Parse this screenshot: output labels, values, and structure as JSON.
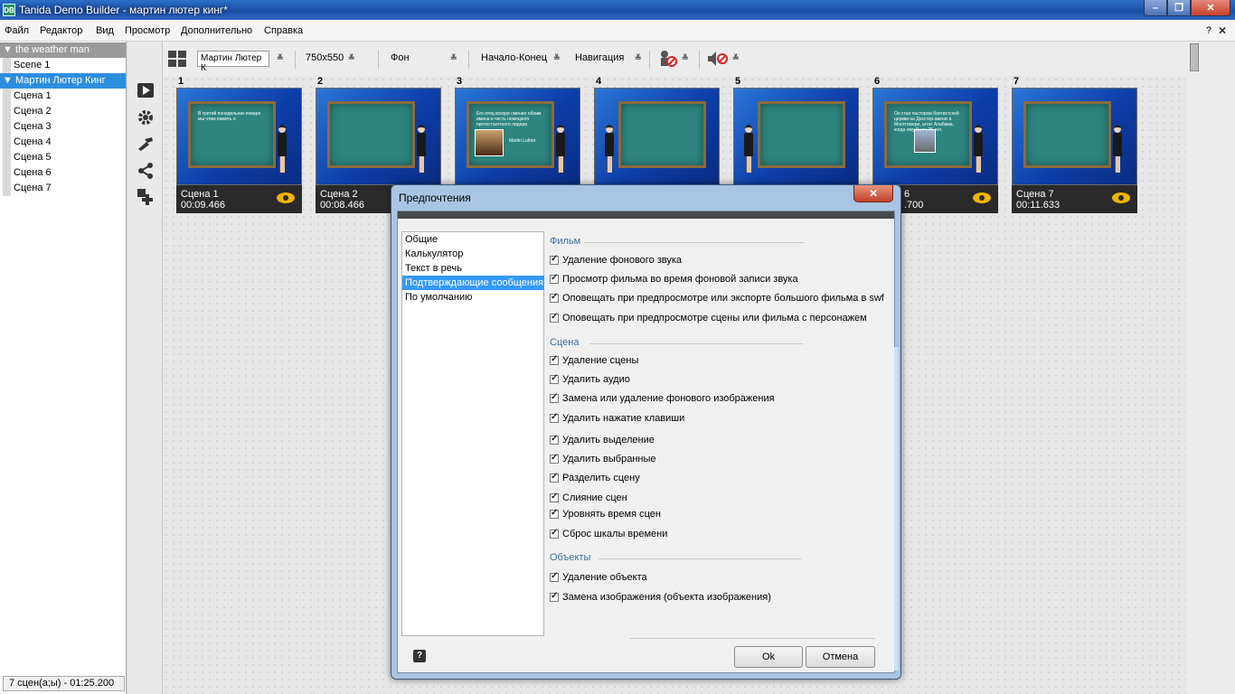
{
  "window": {
    "app_icon_text": "DB",
    "title": "Tanida Demo Builder - мартин лютер кинг*",
    "minimize": "‒",
    "maximize": "❐",
    "close": "✕"
  },
  "menu": {
    "items": [
      "Файл",
      "Редактор",
      "Вид",
      "Просмотр",
      "Дополнительно",
      "Справка"
    ],
    "help": "?",
    "close": "✕"
  },
  "project_tree": {
    "projects": [
      {
        "name": "the weather man",
        "scenes": [
          "Scene 1"
        ]
      },
      {
        "name": "Мартин Лютер Кинг",
        "scenes": [
          "Сцена 1",
          "Сцена 2",
          "Сцена 3",
          "Сцена 4",
          "Сцена 5",
          "Сцена 6",
          "Сцена 7"
        ]
      }
    ],
    "expand_glyph": "▼",
    "status": "7 сцен(а;ы) - 01:25.200"
  },
  "toolbar": {
    "project_select": "Мартин Лютер К",
    "size": "750x550",
    "background": "Фон",
    "start_end": "Начало-Конец",
    "navigation": "Навигация",
    "chevron": "≚"
  },
  "scenes": [
    {
      "num": "1",
      "name": "Сцена 1",
      "time": "00:09.466",
      "board_text": "В третий понедельник января мы чтим память о"
    },
    {
      "num": "2",
      "name": "Сцена 2",
      "time": "00:08.466",
      "board_text": ""
    },
    {
      "num": "3",
      "name": "",
      "time": "",
      "board_text": "Его отец вскоре сменил обоим имена в честь немецкого протестантского лидера",
      "caption": "Martin Luther"
    },
    {
      "num": "4",
      "name": "",
      "time": "",
      "board_text": ""
    },
    {
      "num": "5",
      "name": "",
      "time": "",
      "board_text": ""
    },
    {
      "num": "6",
      "name": "6",
      "time": ".700",
      "board_text": "Он стал пастором баптистской церкви на Декстер-авеню в Монтгомери, штат Алабама, когда ему было 25 лет."
    },
    {
      "num": "7",
      "name": "Сцена 7",
      "time": "00:11.633",
      "board_text": ""
    }
  ],
  "dialog": {
    "title": "Предпочтения",
    "close": "✕",
    "nav": [
      "Общие",
      "Калькулятор",
      "Текст в речь",
      "Подтверждающие сообщения",
      "По умолчанию"
    ],
    "selected_nav": "Подтверждающие сообщения",
    "sections": {
      "film": {
        "title": "Фильм",
        "options": [
          {
            "label": "Удаление фонового звука",
            "checked": true
          },
          {
            "label": "Просмотр фильма во время фоновой записи звука",
            "checked": true
          },
          {
            "label": "Оповещать при предпросмотре или экспорте большого фильма в swf",
            "checked": true
          },
          {
            "label": "Оповещать при предпросмотре сцены или фильма с персонажем",
            "checked": true
          }
        ]
      },
      "scene": {
        "title": "Сцена",
        "options": [
          {
            "label": "Удаление сцены",
            "checked": true
          },
          {
            "label": "Удалить аудио",
            "checked": true
          },
          {
            "label": "Замена или удаление фонового изображения",
            "checked": true
          },
          {
            "label": "Удалить нажатие клавиши",
            "checked": true
          },
          {
            "label": "Удалить выделение",
            "checked": true
          },
          {
            "label": "Удалить выбранные",
            "checked": true
          },
          {
            "label": "Разделить сцену",
            "checked": true
          },
          {
            "label": "Слияние сцен",
            "checked": true
          },
          {
            "label": "Уровнять время сцен",
            "checked": true
          },
          {
            "label": "Сброс шкалы времени",
            "checked": true
          }
        ]
      },
      "objects": {
        "title": "Объекты",
        "options": [
          {
            "label": "Удаление объекта",
            "checked": true
          },
          {
            "label": "Замена изображения (объекта изображения)",
            "checked": true
          }
        ]
      }
    },
    "help": "?",
    "ok": "Ok",
    "cancel": "Отмена"
  },
  "colors": {
    "selection": "#3399ff",
    "active_project": "#2e8ede",
    "eye": "#f0b400"
  }
}
